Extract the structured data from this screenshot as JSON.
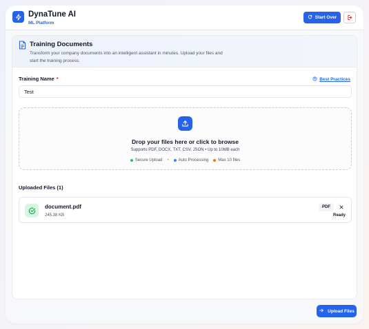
{
  "header": {
    "app_title": "DynaTune AI",
    "app_subtitle": "ML Platform",
    "start_over_label": "Start Over",
    "icons": {
      "logo": "bolt-icon",
      "start_over": "refresh-icon",
      "exit": "logout-icon"
    }
  },
  "card": {
    "title": "Training Documents",
    "description": "Transform your company documents into an intelligent assistant in minutes. Upload your files and start the training process.",
    "icon": "document-icon"
  },
  "form": {
    "name_label": "Training Name",
    "required_mark": "*",
    "best_practices_label": "Best Practices",
    "name_value": "Test"
  },
  "dropzone": {
    "title": "Drop your files here or click to browse",
    "subtitle": "Supports PDF, DOCX, TXT, CSV, JSON • Up to 10MB each",
    "features": [
      {
        "label": "Secure Upload",
        "color": "#22c55e"
      },
      {
        "label": "Auto Processing",
        "color": "#3b82f6"
      },
      {
        "label": "Max 10 files",
        "color": "#f97316"
      }
    ],
    "separator": "•"
  },
  "uploaded": {
    "heading": "Uploaded Files (1)",
    "files": [
      {
        "name": "document.pdf",
        "size": "245.38 KB",
        "type": "PDF",
        "status": "Ready"
      }
    ]
  },
  "footer": {
    "upload_label": "Upload Files"
  },
  "colors": {
    "accent": "#2563eb",
    "success": "#16a34a",
    "danger": "#dc2626"
  }
}
